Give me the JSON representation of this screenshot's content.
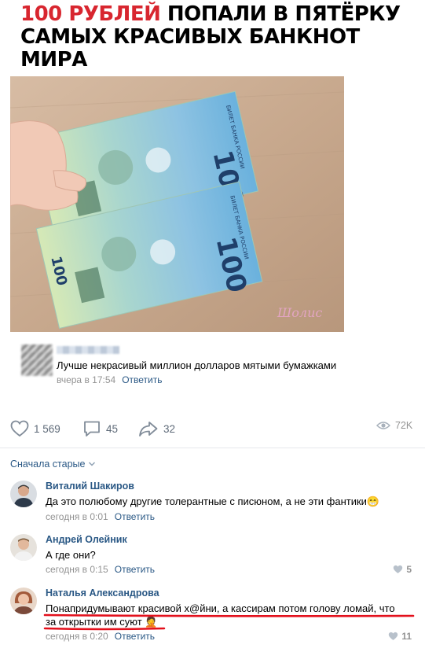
{
  "headline": {
    "accent": "100 РУБЛЕЙ",
    "rest": " ПОПАЛИ В ПЯТЁРКУ САМЫХ КРАСИВЫХ БАНКНОТ МИРА"
  },
  "photo": {
    "banknote_numeral": "100",
    "banknote_text": "БИЛЕТ БАНКА РОССИИ",
    "watermark": "Шолис"
  },
  "top_comment": {
    "text": "Лучше некрасивый миллион долларов мятыми бумажками",
    "time": "вчера в 17:54",
    "reply": "Ответить"
  },
  "stats": {
    "likes": "1 569",
    "comments": "45",
    "shares": "32",
    "views": "72K"
  },
  "sort_label": "Сначала старые",
  "comments": [
    {
      "author": "Виталий Шакиров",
      "lines": [
        "Да это полюбому другие толерантные с писюном, а не эти фантики😁"
      ],
      "time": "сегодня в 0:01",
      "reply": "Ответить",
      "likes": ""
    },
    {
      "author": "Андрей Олейник",
      "lines": [
        "А где они?"
      ],
      "time": "сегодня в 0:15",
      "reply": "Ответить",
      "likes": "5"
    },
    {
      "author": "Наталья Александрова",
      "lines": [
        "Понапридумывают красивой х@йни, а кассирам потом голову ломай, что",
        "за открытки им суют 🤦"
      ],
      "time": "сегодня в 0:20",
      "reply": "Ответить",
      "likes": "11"
    }
  ],
  "colors": {
    "accent_red": "#d8262f",
    "link_blue": "#2a5885",
    "meta_gray": "#939393",
    "underline_red": "#e3101c"
  }
}
